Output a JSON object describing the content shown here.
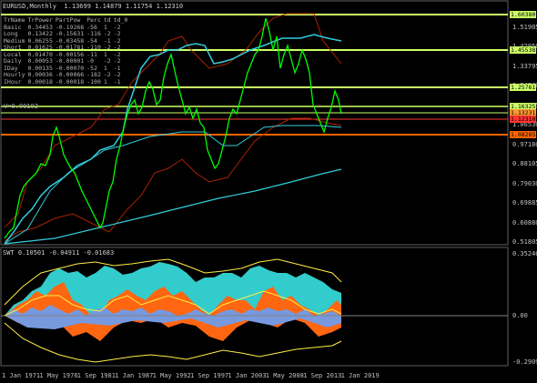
{
  "header": {
    "title": "EURUSD,Monthly  1.13699 1.14879 1.11754 1.12310"
  },
  "indicator": {
    "title": "SWT 0.10501 -0.04911 -0.01683"
  },
  "info_table": {
    "headers": [
      "TrName",
      "TrPower",
      "PartPow",
      "Perc",
      "td",
      "td_0"
    ],
    "rows": [
      [
        "Basic",
        "0.34453",
        "-0.19268",
        "-56",
        "1",
        "-2"
      ],
      [
        "Long",
        "0.13422",
        "-0.15631",
        "-116",
        "-2",
        "-2"
      ],
      [
        "Medium",
        "0.06255",
        "-0.03458",
        "-54",
        "-1",
        "-2"
      ],
      [
        "Short",
        "0.01625",
        "-0.01781",
        "-110",
        "-2",
        "-2"
      ],
      [
        "Local",
        "0.01470",
        "-0.00156",
        "-11",
        "1",
        "-2"
      ],
      [
        "Daily",
        "0.00053",
        "-0.00001",
        "-0",
        "-2",
        "-2"
      ],
      [
        "IDay",
        "0.00135",
        "-0.00070",
        "-52",
        "1",
        "-1"
      ],
      [
        "Hourly",
        "0.00036",
        "-0.00066",
        "-182",
        "-2",
        "-2"
      ],
      [
        "IHour",
        "0.00018",
        "-0.00018",
        "-100",
        "1",
        "-1"
      ]
    ],
    "footer": "V=0.00102"
  },
  "price_axis": [
    "1.51905",
    "1.42950",
    "1.33795",
    "1.24740",
    "1.15725",
    "1.06530",
    "0.97180",
    "0.88105",
    "0.79030",
    "0.69885",
    "0.60880",
    "0.51805"
  ],
  "indicator_axis": [
    "0.35246",
    "0.00",
    "-0.29098"
  ],
  "price_labels": [
    {
      "text": "1.60380",
      "color": "#ccff66"
    },
    {
      "text": "1.45538",
      "color": "#ccff66"
    },
    {
      "text": "1.25761",
      "color": "#ccff66"
    },
    {
      "text": "1.16325",
      "color": "#ccff66"
    },
    {
      "text": "1.13231",
      "color": "#ff9933"
    },
    {
      "text": "1.12310",
      "color": "#ff3333"
    },
    {
      "text": "1.08285",
      "color": "#ff6600"
    }
  ],
  "time_axis": [
    "1 Jan 1971",
    "1 May 1976",
    "1 Sep 1981",
    "1 Jan 1987",
    "1 May 1992",
    "1 Sep 1997",
    "1 Jan 2003",
    "1 May 2008",
    "1 Sep 2013",
    "1 Jan 2019"
  ],
  "colors": {
    "background": "#000000",
    "price_line": "#00ff00",
    "level_line": "#ccff66",
    "support_line": "#ff6600",
    "channel_cyan": "#33ccdd",
    "channel_red": "#aa2200",
    "swt_cyan": "#33cccc",
    "swt_orange": "#ff6611",
    "swt_blue": "#7799dd",
    "swt_yellow": "#ffee44"
  }
}
